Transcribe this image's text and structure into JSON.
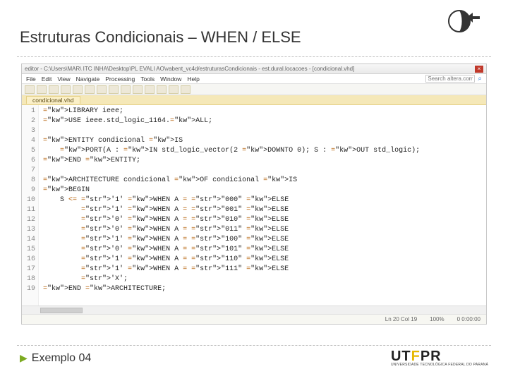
{
  "title": "Estruturas Condicionais – WHEN / ELSE",
  "caption": "Exemplo 04",
  "logo": {
    "label": "UTFPR",
    "subtitle": "UNIVERSIDADE TECNOLÓGICA FEDERAL DO PARANÁ"
  },
  "editor": {
    "title": "editor - C:\\Users\\MAR\\  ITC INHA\\Desktop\\PL EVALI AO\\vabent_vc4d/estruturasCondicionais - est.dural.locacoes - [condicional.vhd]",
    "menu": [
      "File",
      "Edit",
      "View",
      "Navigate",
      "Processing",
      "Tools",
      "Window",
      "Help"
    ],
    "search_placeholder": "Search altera.com",
    "tab": "condicional.vhd",
    "status": {
      "ln_col": "Ln 20   Col 19",
      "pct": "100%",
      "encoding": "0 0:00:00"
    },
    "code_lines": [
      {
        "n": 1,
        "raw": "LIBRARY ieee;"
      },
      {
        "n": 2,
        "raw": "USE ieee.std_logic_1164.ALL;"
      },
      {
        "n": 3,
        "raw": ""
      },
      {
        "n": 4,
        "raw": "ENTITY condicional IS"
      },
      {
        "n": 5,
        "raw": "    PORT(A : IN std_logic_vector(2 DOWNTO 0); S : OUT std_logic);"
      },
      {
        "n": 6,
        "raw": "END ENTITY;"
      },
      {
        "n": 7,
        "raw": ""
      },
      {
        "n": 8,
        "raw": "ARCHITECTURE condicional OF condicional IS"
      },
      {
        "n": 9,
        "raw": "BEGIN"
      },
      {
        "n": 10,
        "raw": "    S <= '1' WHEN A = \"000\" ELSE"
      },
      {
        "n": 11,
        "raw": "         '1' WHEN A = \"001\" ELSE"
      },
      {
        "n": 12,
        "raw": "         '0' WHEN A = \"010\" ELSE"
      },
      {
        "n": 13,
        "raw": "         '0' WHEN A = \"011\" ELSE"
      },
      {
        "n": 14,
        "raw": "         '1' WHEN A = \"100\" ELSE"
      },
      {
        "n": 15,
        "raw": "         '0' WHEN A = \"101\" ELSE"
      },
      {
        "n": 16,
        "raw": "         '1' WHEN A = \"110\" ELSE"
      },
      {
        "n": 17,
        "raw": "         '1' WHEN A = \"111\" ELSE"
      },
      {
        "n": 18,
        "raw": "         'X';"
      },
      {
        "n": 19,
        "raw": "END ARCHITECTURE;"
      }
    ]
  }
}
